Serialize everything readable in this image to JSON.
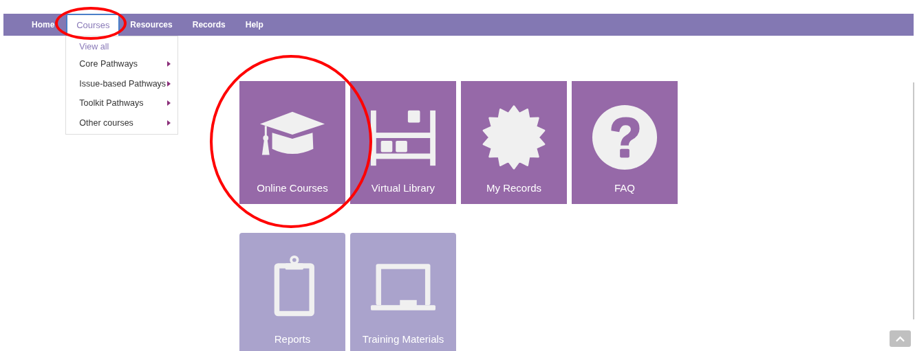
{
  "nav": {
    "items": [
      {
        "label": "Home",
        "selected": false,
        "circled": false
      },
      {
        "label": "Courses",
        "selected": true,
        "circled": true
      },
      {
        "label": "Resources",
        "selected": false,
        "circled": false
      },
      {
        "label": "Records",
        "selected": false,
        "circled": false
      },
      {
        "label": "Help",
        "selected": false,
        "circled": false
      }
    ]
  },
  "dropdown": {
    "items": [
      {
        "label": "View all",
        "selected": true,
        "has_submenu": false
      },
      {
        "label": "Core Pathways",
        "selected": false,
        "has_submenu": true
      },
      {
        "label": "Issue-based Pathways",
        "selected": false,
        "has_submenu": true
      },
      {
        "label": "Toolkit Pathways",
        "selected": false,
        "has_submenu": true
      },
      {
        "label": "Other courses",
        "selected": false,
        "has_submenu": true
      }
    ]
  },
  "tile_rows": [
    [
      {
        "label": "Online Courses",
        "disabled": false,
        "circled": true
      },
      {
        "label": "Virtual Library",
        "disabled": false,
        "circled": false
      },
      {
        "label": "My Records",
        "disabled": false,
        "circled": false
      },
      {
        "label": "FAQ",
        "disabled": false,
        "circled": false
      }
    ],
    [
      {
        "label": "Reports",
        "disabled": true,
        "circled": false
      },
      {
        "label": "Training Materials",
        "disabled": true,
        "circled": false
      }
    ]
  ]
}
